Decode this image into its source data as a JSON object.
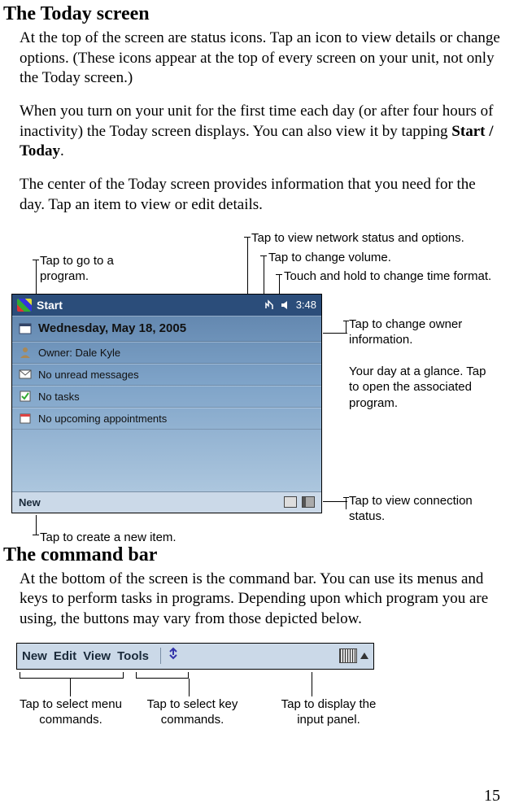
{
  "section1": {
    "heading": "The Today screen",
    "para1": "At the top of the screen are status icons. Tap an icon to view details or change options. (These icons appear at the top of every screen on your unit, not only the Today screen.)",
    "para2a": "When you turn on your unit for the first time each day (or after four hours of inactivity) the Today screen displays. You can also view it by tapping ",
    "para2bold": "Start / Today",
    "para2b": ".",
    "para3": "The center of the Today screen provides information that you need for the day. Tap an item to view or edit details."
  },
  "callouts": {
    "goto": "Tap to go to a program.",
    "network": "Tap to view network status and options.",
    "volume": "Tap to change volume.",
    "time": "Touch and hold to change time format.",
    "owner": "Tap to change owner information.",
    "glance": "Your day at a glance. Tap to open the associated program.",
    "conn": "Tap to view connection status.",
    "newitem": "Tap to create a new item."
  },
  "today": {
    "title": "Start",
    "clock": "3:48",
    "date": "Wednesday, May 18, 2005",
    "owner": "Owner: Dale Kyle",
    "msgs": "No unread messages",
    "tasks": "No tasks",
    "appts": "No upcoming appointments",
    "new": "New"
  },
  "section2": {
    "heading": "The command bar",
    "para": "At the bottom of the screen is the command bar. You can use its menus and keys to perform tasks in programs. Depending upon which program you are using, the buttons may vary from those depicted below."
  },
  "commandbar": {
    "m1": "New",
    "m2": "Edit",
    "m3": "View",
    "m4": "Tools"
  },
  "cb_callouts": {
    "menu": "Tap to select menu commands.",
    "key": "Tap to select key commands.",
    "input": "Tap to display the input panel."
  },
  "page": "15"
}
